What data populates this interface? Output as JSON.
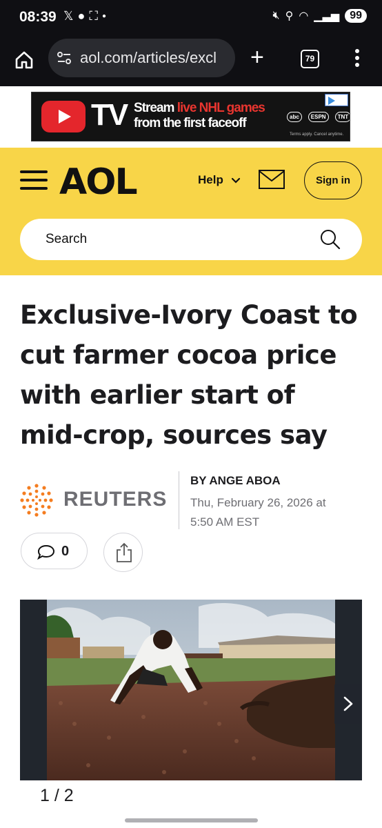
{
  "status_bar": {
    "time": "08:39",
    "left_icons": [
      "x-icon",
      "globe-icon",
      "screenshot-icon",
      "dot-icon"
    ],
    "right_icons": [
      "mute-icon",
      "location-icon",
      "wifi-icon",
      "signal-icon"
    ],
    "battery": "99"
  },
  "browser": {
    "url": "aol.com/articles/excl",
    "tab_count": "79"
  },
  "ad": {
    "brand": "TV",
    "line1_prefix": "Stream ",
    "line1_highlight": "live NHL games",
    "line2": "from the first faceoff",
    "networks": [
      "abc",
      "ESPN",
      "TNT"
    ],
    "terms": "Terms apply. Cancel anytime."
  },
  "header": {
    "logo": "AOL",
    "help_label": "Help",
    "signin_label": "Sign in",
    "search_placeholder": "Search"
  },
  "article": {
    "headline": "Exclusive-Ivory Coast to cut farmer cocoa price with earlier start of mid-crop, sources say",
    "source": "REUTERS",
    "byline": "BY ANGE ABOA",
    "date": "Thu, February 26, 2026 at 5:50 AM EST",
    "comment_count": "0"
  },
  "gallery": {
    "counter": "1 / 2"
  },
  "colors": {
    "aol_yellow": "#f8d548",
    "browser_dark": "#0f0f13",
    "reuters_orange": "#f47d20"
  }
}
